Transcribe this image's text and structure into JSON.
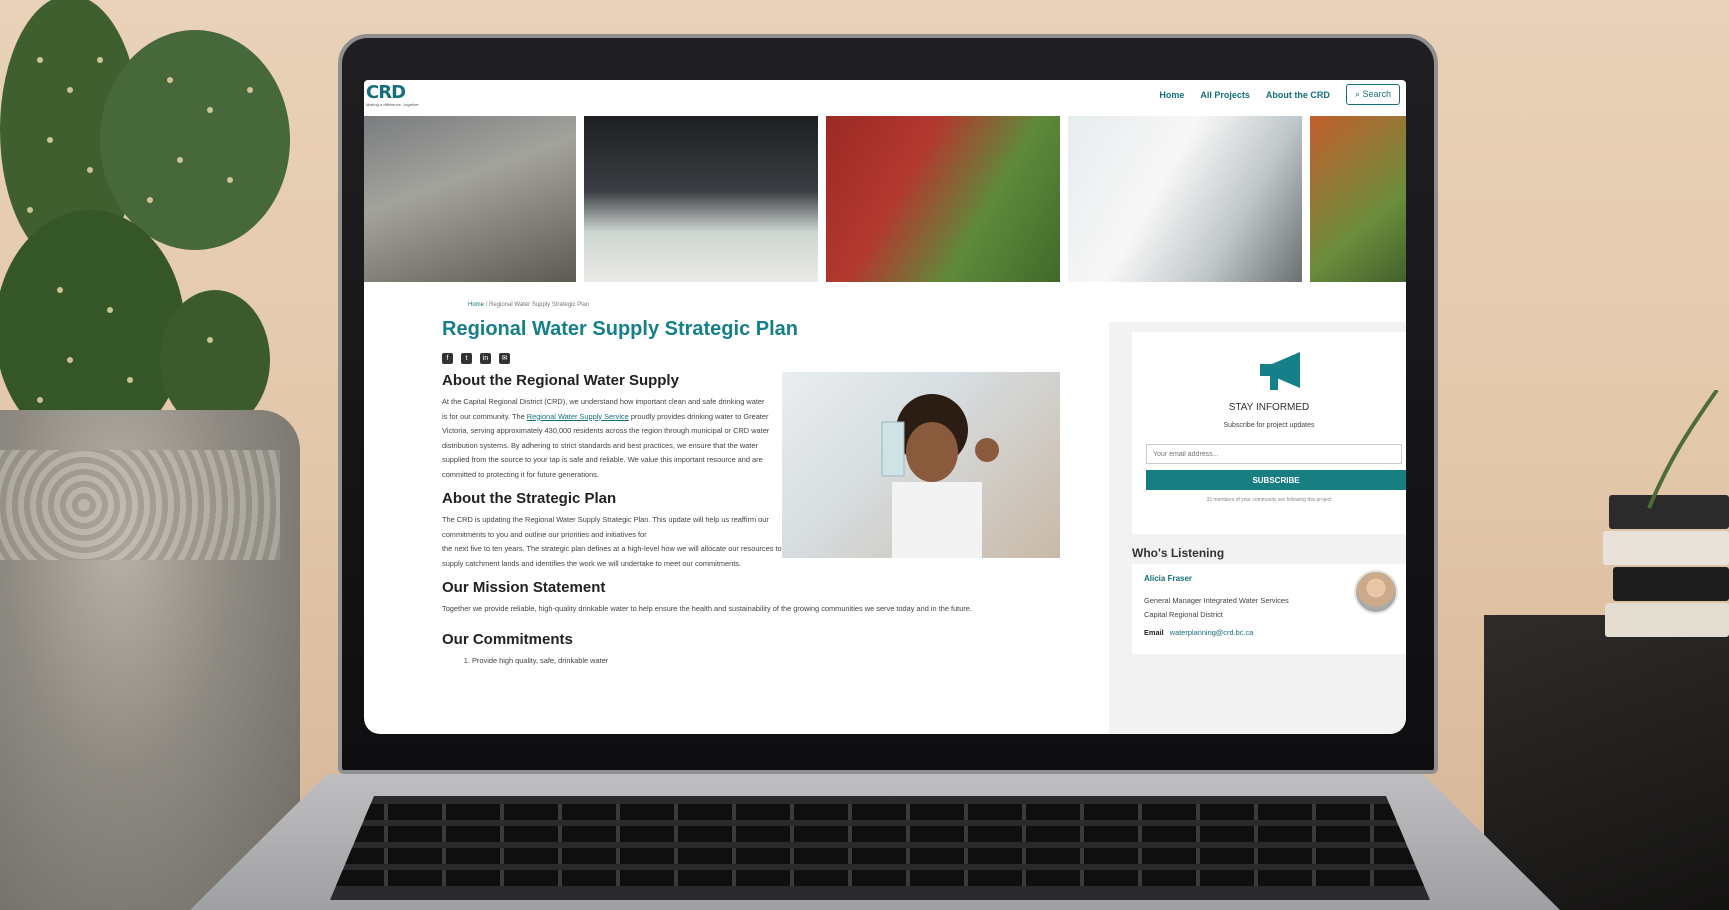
{
  "site": {
    "logo_mark": "CRD",
    "logo_tagline": "Making a difference...together"
  },
  "nav": {
    "items": [
      "Home",
      "All Projects",
      "About the CRD"
    ],
    "search_label": "Search"
  },
  "breadcrumb": {
    "home": "Home",
    "separator": "/",
    "current": "Regional Water Supply Strategic Plan"
  },
  "page": {
    "title": "Regional Water Supply Strategic Plan",
    "share_icons": [
      "facebook-icon",
      "twitter-icon",
      "linkedin-icon",
      "email-icon"
    ],
    "sections": {
      "about_supply": {
        "heading": "About the Regional Water Supply",
        "text_before_link": "At the Capital Regional District (CRD), we understand how important clean and safe drinking water is for our community. The ",
        "link": "Regional Water Supply Service",
        "text_after_link": " proudly provides drinking water to Greater Victoria, serving approximately 430,000 residents across the region through municipal or CRD water distribution systems. By adhering to strict standards and best practices, we ensure that the water supplied from the source to your tap is safe and reliable. We value this important resource and are committed to protecting it for future generations."
      },
      "about_plan": {
        "heading": "About the Strategic Plan",
        "text_narrow": "The CRD is updating the Regional Water Supply Strategic Plan. This update will help us reaffirm our commitments to you and outline our priorities and initiatives for",
        "text_wide": "the next five to ten years. The strategic plan defines at a high-level how we will allocate our resources to manage, maintain and safeguard the water supply, transmission system and water supply catchment lands and identifies the work we will undertake to meet our commitments."
      },
      "mission": {
        "heading": "Our Mission Statement",
        "text": "Together we provide reliable, high-quality drinkable water to help ensure the health and sustainability of the growing communities we serve today and in the future."
      },
      "commitments": {
        "heading": "Our Commitments",
        "items": [
          "Provide high quality, safe, drinkable water"
        ]
      }
    }
  },
  "sidebar": {
    "stay_informed": {
      "title": "STAY INFORMED",
      "subtitle": "Subscribe for project updates",
      "email_placeholder": "Your email address...",
      "button": "SUBSCRIBE",
      "note": "33 members of your community are following this project"
    },
    "whos_listening": {
      "title": "Who's Listening",
      "name": "Alicia Fraser",
      "role_line1": "General Manager Integrated Water Services",
      "role_line2": "Capital Regional District",
      "email_label": "Email",
      "email": "waterplanning@crd.bc.ca"
    }
  },
  "colors": {
    "brand_teal": "#16808a",
    "button_teal": "#177f82"
  }
}
